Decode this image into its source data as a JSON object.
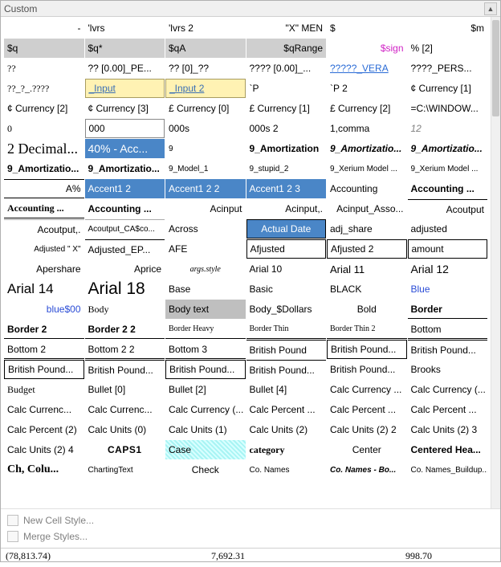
{
  "title": "Custom",
  "menu": {
    "new_cell_style": "New Cell Style...",
    "merge_styles": "Merge Styles..."
  },
  "below": {
    "a": "(78,813.74)",
    "b": "7,692.31",
    "c": "998.70"
  },
  "rows": [
    [
      {
        "t": "-",
        "cls": "right"
      },
      {
        "t": "'lvrs"
      },
      {
        "t": "'lvrs 2"
      },
      {
        "t": "\"X\" MEN",
        "cls": "right"
      },
      {
        "t": "$"
      },
      {
        "t": "$m",
        "cls": "right"
      }
    ],
    [
      {
        "t": "$q",
        "cls": "hdr-gray"
      },
      {
        "t": "$q*",
        "cls": "hdr-gray"
      },
      {
        "t": "$qA",
        "cls": "hdr-gray"
      },
      {
        "t": "$qRange",
        "cls": "hdr-gray right"
      },
      {
        "t": "$sign",
        "cls": "magenta right"
      },
      {
        "t": "% [2]"
      }
    ],
    [
      {
        "t": "??",
        "cls": "serif"
      },
      {
        "t": "?? [0.00]_PE..."
      },
      {
        "t": "?? [0]_??"
      },
      {
        "t": "???? [0.00]_..."
      },
      {
        "t": "?????_VERA",
        "cls": "linkblue"
      },
      {
        "t": "????_PERS..."
      }
    ],
    [
      {
        "t": "??_?_.????",
        "cls": "serif"
      },
      {
        "t": "_Input",
        "cls": "input-y"
      },
      {
        "t": "_Input 2",
        "cls": "input-y"
      },
      {
        "t": "`P"
      },
      {
        "t": "`P 2"
      },
      {
        "t": "¢ Currency [1]"
      }
    ],
    [
      {
        "t": "¢ Currency [2]"
      },
      {
        "t": "¢ Currency [3]"
      },
      {
        "t": "£ Currency [0]"
      },
      {
        "t": "£ Currency [1]"
      },
      {
        "t": "£ Currency [2]"
      },
      {
        "t": "=C:\\WINDOW..."
      }
    ],
    [
      {
        "t": "0",
        "cls": "serif"
      },
      {
        "t": "000",
        "cls": "border-box"
      },
      {
        "t": "000s"
      },
      {
        "t": "000s 2"
      },
      {
        "t": "1,comma"
      },
      {
        "t": "12",
        "cls": "italic gray-txt"
      }
    ],
    [
      {
        "t": "2 Decimal...",
        "cls": "bigserif"
      },
      {
        "t": "40% - Acc...",
        "cls": "sel-blue arial12"
      },
      {
        "t": "9",
        "cls": "small"
      },
      {
        "t": "9_Amortization",
        "cls": "bold"
      },
      {
        "t": "9_Amortizatio...",
        "cls": "italic bold"
      },
      {
        "t": "9_Amortizatio...",
        "cls": "italic bold"
      }
    ],
    [
      {
        "t": "9_Amortizatio...",
        "cls": "bold"
      },
      {
        "t": "9_Amortizatio...",
        "cls": "bold"
      },
      {
        "t": "9_Model_1",
        "cls": "small"
      },
      {
        "t": "9_stupid_2",
        "cls": "small"
      },
      {
        "t": "9_Xerium Model ...",
        "cls": "small"
      },
      {
        "t": "9_Xerium Model ...",
        "cls": "small"
      }
    ],
    [
      {
        "t": "A%",
        "cls": "right border-bt"
      },
      {
        "t": "Accent1 2",
        "cls": "sel-blue"
      },
      {
        "t": "Accent1 2 2",
        "cls": "sel-blue"
      },
      {
        "t": "Accent1 2 3",
        "cls": "sel-blue"
      },
      {
        "t": "Accounting"
      },
      {
        "t": "Accounting ...",
        "cls": "bold"
      }
    ],
    [
      {
        "t": "Accounting ...",
        "cls": "bold serif border-b"
      },
      {
        "t": "Accounting ...",
        "cls": "bold"
      },
      {
        "t": "Acinput",
        "cls": "right"
      },
      {
        "t": "Acinput,.",
        "cls": "right"
      },
      {
        "t": "Acinput_Asso...",
        "cls": "right"
      },
      {
        "t": "Acoutput",
        "cls": "right border-t"
      }
    ],
    [
      {
        "t": "Acoutput,.",
        "cls": "right thin-border-t"
      },
      {
        "t": "Acoutput_CA$co...",
        "cls": "small thin-border-t"
      },
      {
        "t": "Across"
      },
      {
        "t": "Actual Date",
        "cls": "sel-blue center border-cell"
      },
      {
        "t": "adj_share"
      },
      {
        "t": "adjusted"
      }
    ],
    [
      {
        "t": "Adjusted \" X\"",
        "cls": "right small"
      },
      {
        "t": "Adjusted_EP...",
        "cls": "border-t"
      },
      {
        "t": "AFE"
      },
      {
        "t": "Afjusted",
        "cls": "border-cell"
      },
      {
        "t": "Afjusted 2",
        "cls": "border-cell"
      },
      {
        "t": "amount",
        "cls": "border-cell"
      }
    ],
    [
      {
        "t": "Apershare",
        "cls": "right"
      },
      {
        "t": "Aprice",
        "cls": "right"
      },
      {
        "t": "args.style",
        "cls": "serif italic center small"
      },
      {
        "t": "Arial 10",
        "cls": "arial10"
      },
      {
        "t": "Arial 11",
        "cls": "arial11"
      },
      {
        "t": "Arial 12",
        "cls": "arial12"
      }
    ],
    [
      {
        "t": "Arial 14",
        "cls": "arial14"
      },
      {
        "t": "Arial 18",
        "cls": "arial18"
      },
      {
        "t": "Base"
      },
      {
        "t": "Basic"
      },
      {
        "t": "BLACK"
      },
      {
        "t": "Blue",
        "cls": "blue-txt"
      }
    ],
    [
      {
        "t": "blue$00",
        "cls": "blue-txt right"
      },
      {
        "t": "Body",
        "cls": "serif"
      },
      {
        "t": "Body text",
        "cls": "bodytext-sel"
      },
      {
        "t": "Body_$Dollars"
      },
      {
        "t": "Bold",
        "cls": "center"
      },
      {
        "t": "Border",
        "cls": "bold border-b"
      }
    ],
    [
      {
        "t": "Border 2",
        "cls": "bold border-b"
      },
      {
        "t": "Border 2 2",
        "cls": "bold border-b"
      },
      {
        "t": "Border Heavy",
        "cls": "serif small border-b"
      },
      {
        "t": "Border Thin",
        "cls": "serif small border-b"
      },
      {
        "t": "Border Thin 2",
        "cls": "serif small border-b"
      },
      {
        "t": "Bottom",
        "cls": "border-b"
      }
    ],
    [
      {
        "t": "Bottom 2",
        "cls": "border-b"
      },
      {
        "t": "Bottom 2 2",
        "cls": "border-b"
      },
      {
        "t": "Bottom 3",
        "cls": "border-b"
      },
      {
        "t": "British Pound",
        "cls": "border-t"
      },
      {
        "t": "British Pound...",
        "cls": "border-cell"
      },
      {
        "t": "British Pound...",
        "cls": "border-t"
      }
    ],
    [
      {
        "t": "British Pound...",
        "cls": "border-cell"
      },
      {
        "t": "British Pound...",
        "cls": "border-t"
      },
      {
        "t": "British Pound...",
        "cls": "border-cell"
      },
      {
        "t": "British Pound...",
        "cls": "border-t"
      },
      {
        "t": "British Pound..."
      },
      {
        "t": "Brooks"
      }
    ],
    [
      {
        "t": "Budget",
        "cls": "serif"
      },
      {
        "t": "Bullet [0]"
      },
      {
        "t": "Bullet [2]"
      },
      {
        "t": "Bullet [4]"
      },
      {
        "t": "Calc Currency ..."
      },
      {
        "t": "Calc Currency (..."
      }
    ],
    [
      {
        "t": "Calc Currenc..."
      },
      {
        "t": "Calc Currenc..."
      },
      {
        "t": "Calc Currency (..."
      },
      {
        "t": "Calc Percent ..."
      },
      {
        "t": "Calc Percent ..."
      },
      {
        "t": "Calc Percent ..."
      }
    ],
    [
      {
        "t": "Calc Percent (2)"
      },
      {
        "t": "Calc Units (0)"
      },
      {
        "t": "Calc Units (1)"
      },
      {
        "t": "Calc Units (2)"
      },
      {
        "t": "Calc Units (2) 2"
      },
      {
        "t": "Calc Units (2) 3"
      }
    ],
    [
      {
        "t": "Calc Units (2) 4"
      },
      {
        "t": "CAPS1",
        "cls": "caps center"
      },
      {
        "t": "Case",
        "cls": "case-cyan"
      },
      {
        "t": "category",
        "cls": "serif bold"
      },
      {
        "t": "Center",
        "cls": "center"
      },
      {
        "t": "Centered Hea...",
        "cls": "bold"
      }
    ],
    [
      {
        "t": "Ch, Colu...",
        "cls": "bold serif arial12"
      },
      {
        "t": "ChartingText",
        "cls": "small"
      },
      {
        "t": "Check",
        "cls": "center"
      },
      {
        "t": "Co. Names",
        "cls": "small"
      },
      {
        "t": "Co. Names - Bo...",
        "cls": "italic bold small"
      },
      {
        "t": "Co. Names_Buildup...",
        "cls": "small"
      }
    ]
  ]
}
